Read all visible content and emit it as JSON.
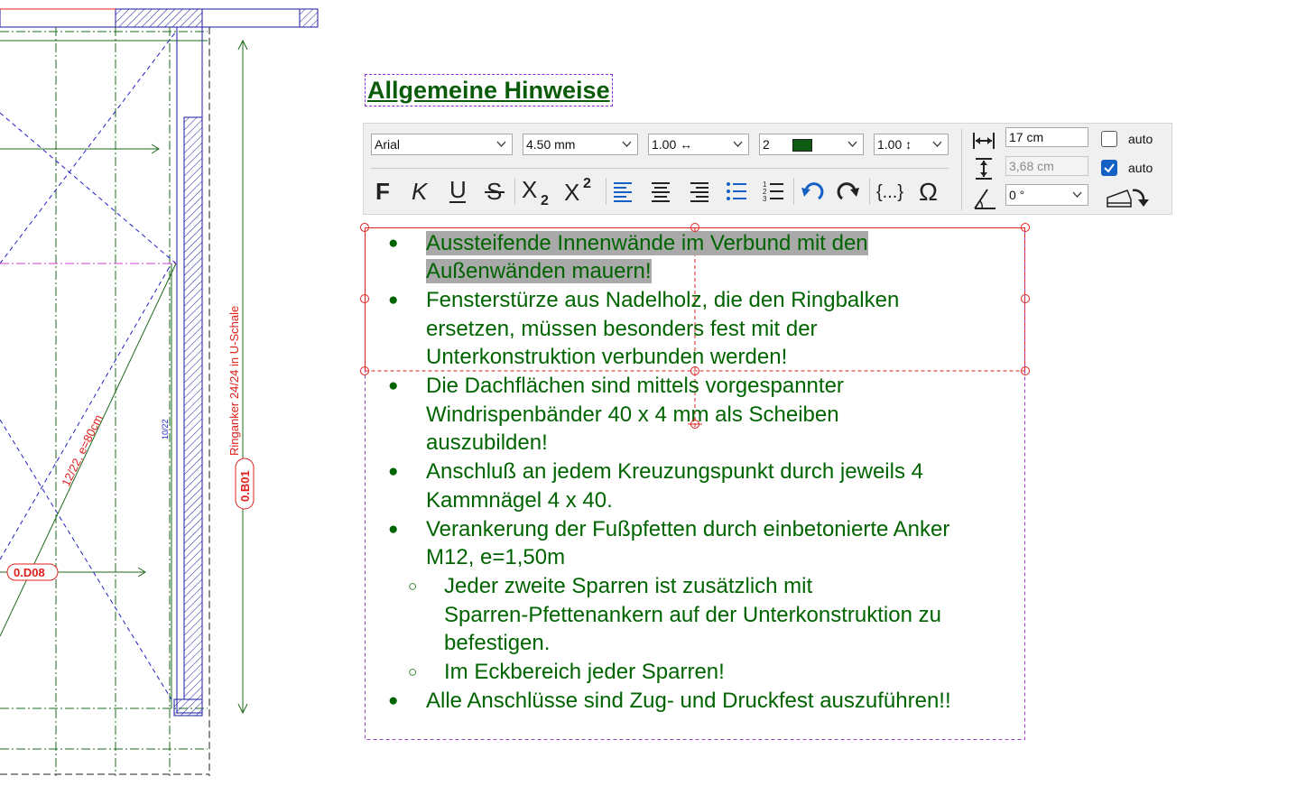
{
  "drawing": {
    "dim_vertical": "Ringanker 24/24 in U-Schale",
    "label_b01": "0.B01",
    "label_d08": "0.D08",
    "diag_text": "12/22, e=80cm",
    "small_text": "10/22"
  },
  "title": "Allgemeine Hinweise",
  "toolbar": {
    "font": "Arial",
    "size": "4.50 mm",
    "width_factor": "1.00 ↔",
    "pen": "2",
    "line_spacing": "1.00 ↕",
    "text_width": "17 cm",
    "text_height": "3,68 cm",
    "angle": "0 °",
    "auto_width_label": "auto",
    "auto_height_label": "auto",
    "auto_width_checked": false,
    "auto_height_checked": true,
    "pen_color": "#0d5a12",
    "icon_color": "#1560c4"
  },
  "text": {
    "color": "#006400",
    "items": [
      {
        "level": 1,
        "lines": [
          "Aussteifende Innenwände im Verbund mit den",
          "Außenwänden mauern!"
        ],
        "highlighted": true
      },
      {
        "level": 1,
        "lines": [
          "Fensterstürze aus Nadelholz, die den Ringbalken",
          "ersetzen, müssen besonders fest mit der",
          "Unterkonstruktion verbunden werden!"
        ]
      },
      {
        "level": 1,
        "lines": [
          "Die Dachflächen sind mittels vorgespannter",
          "Windrispenbänder 40 x 4 mm als Scheiben",
          "auszubilden!"
        ]
      },
      {
        "level": 1,
        "lines": [
          "Anschluß an jedem Kreuzungspunkt durch jeweils 4",
          "Kammnägel 4 x 40."
        ]
      },
      {
        "level": 1,
        "lines": [
          "Verankerung der Fußpfetten durch einbetonierte Anker",
          "M12, e=1,50m"
        ]
      },
      {
        "level": 2,
        "lines": [
          "Jeder zweite Sparren ist zusätzlich mit",
          "Sparren-Pfettenankern auf der Unterkonstruktion zu",
          "befestigen."
        ]
      },
      {
        "level": 2,
        "lines": [
          "Im Eckbereich jeder Sparren!"
        ]
      },
      {
        "level": 1,
        "lines": [
          "Alle Anschlüsse sind Zug- und Druckfest auszuführen!!"
        ]
      }
    ]
  }
}
